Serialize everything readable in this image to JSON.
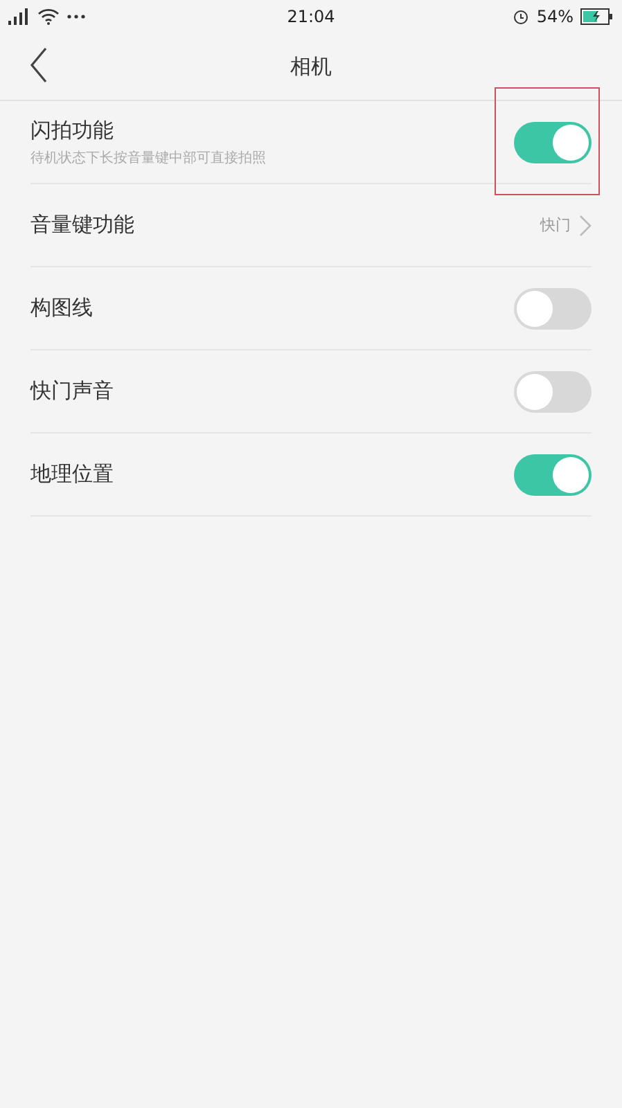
{
  "status_bar": {
    "time": "21:04",
    "battery": "54%"
  },
  "header": {
    "title": "相机"
  },
  "settings": [
    {
      "kind": "toggle",
      "label": "闪拍功能",
      "description": "待机状态下长按音量键中部可直接拍照",
      "on": true,
      "highlighted": true
    },
    {
      "kind": "link",
      "label": "音量键功能",
      "value": "快门"
    },
    {
      "kind": "toggle",
      "label": "构图线",
      "on": false
    },
    {
      "kind": "toggle",
      "label": "快门声音",
      "on": false
    },
    {
      "kind": "toggle",
      "label": "地理位置",
      "on": true
    }
  ]
}
